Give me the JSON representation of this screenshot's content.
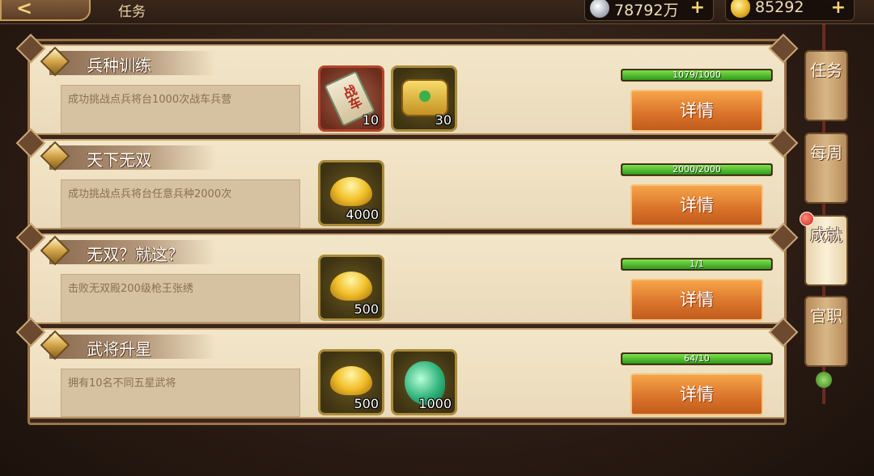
{
  "header": {
    "back_label": "<",
    "title": "任务"
  },
  "currencies": {
    "silver": {
      "icon": "silver-coin-icon",
      "value": "78792万",
      "plus": "+"
    },
    "gold": {
      "icon": "gold-ingot-icon",
      "value": "85292",
      "plus": "+"
    }
  },
  "tasks": [
    {
      "title": "兵种训练",
      "description": "成功挑战点兵将台1000次战车兵营",
      "rewards": [
        {
          "icon": "scroll-icon",
          "label": "战车",
          "qty": "10"
        },
        {
          "icon": "treasure-chest-icon",
          "qty": "30"
        }
      ],
      "progress_text": "1079/1000",
      "progress_fraction": 1.0,
      "button": "详情"
    },
    {
      "title": "天下无双",
      "description": "成功挑战点兵将台任意兵种2000次",
      "rewards": [
        {
          "icon": "gold-ingot-icon",
          "qty": "4000"
        }
      ],
      "progress_text": "2000/2000",
      "progress_fraction": 1.0,
      "button": "详情"
    },
    {
      "title": "无双？就这？",
      "description": "击败无双殿200级枪王张绣",
      "rewards": [
        {
          "icon": "gold-ingot-icon",
          "qty": "500"
        }
      ],
      "progress_text": "1/1",
      "progress_fraction": 1.0,
      "button": "详情"
    },
    {
      "title": "武将升星",
      "description": "拥有10名不同五星武将",
      "rewards": [
        {
          "icon": "gold-ingot-icon",
          "qty": "500"
        },
        {
          "icon": "jade-icon",
          "qty": "1000"
        }
      ],
      "progress_text": "64/10",
      "progress_fraction": 1.0,
      "button": "详情"
    }
  ],
  "side_tabs": [
    {
      "label": "任务",
      "active": false
    },
    {
      "label": "每周",
      "active": false
    },
    {
      "label": "成就",
      "active": true
    },
    {
      "label": "官职",
      "active": false
    }
  ],
  "colors": {
    "progress_green": "#4ec22a",
    "button_orange": "#e07a2c",
    "panel_cream": "#f3e6c8"
  }
}
